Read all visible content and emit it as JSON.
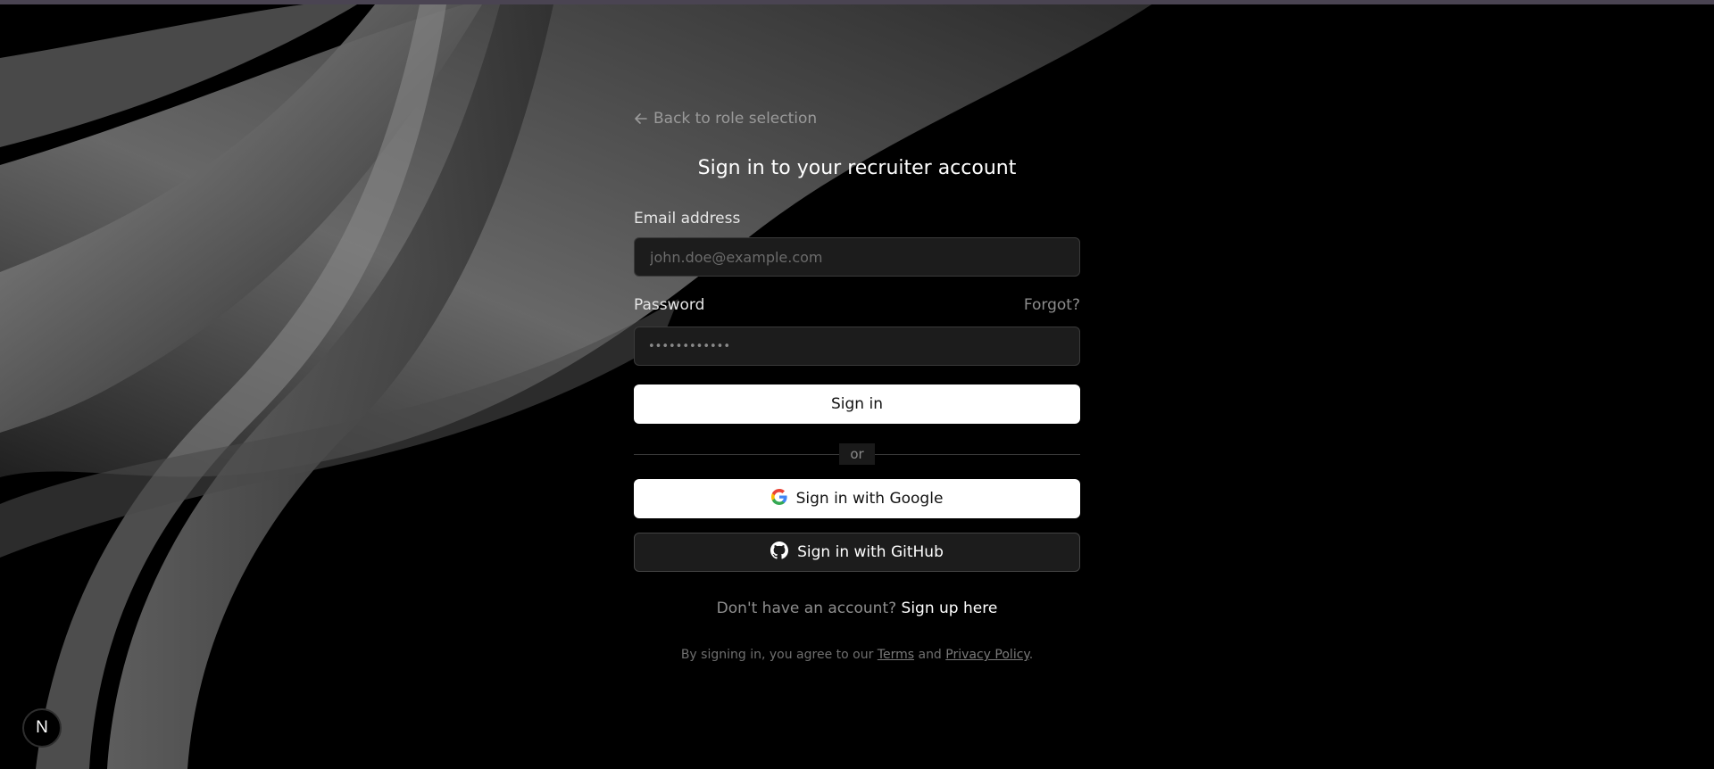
{
  "back_link": {
    "label": "Back to role selection"
  },
  "title": "Sign in to your recruiter account",
  "email": {
    "label": "Email address",
    "placeholder": "john.doe@example.com"
  },
  "password": {
    "label": "Password",
    "forgot_label": "Forgot?",
    "masked_value": "••••••••••••"
  },
  "sign_in_button": "Sign in",
  "divider_label": "or",
  "google_button": "Sign in with Google",
  "github_button": "Sign in with GitHub",
  "signup": {
    "prompt": "Don't have an account?",
    "link": "Sign up here"
  },
  "legal": {
    "prefix": "By signing in, you agree to our",
    "terms": "Terms",
    "and": "and",
    "privacy": "Privacy Policy",
    "suffix": "."
  },
  "badge": {
    "letter": "N"
  },
  "colors": {
    "background": "#000000",
    "primary_button": "#ffffff",
    "input_bg": "#1c1c1c",
    "muted_text": "#8e8e8e"
  },
  "icons": [
    "arrow-left-icon",
    "google-icon",
    "github-icon",
    "nextjs-icon"
  ]
}
